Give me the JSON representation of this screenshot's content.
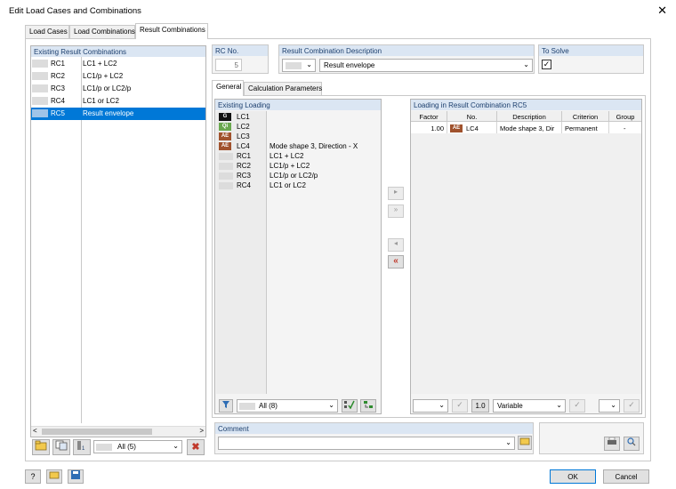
{
  "window": {
    "title": "Edit Load Cases and Combinations",
    "close_glyph": "✕"
  },
  "tabs": [
    {
      "label": "Load Cases"
    },
    {
      "label": "Load Combinations"
    },
    {
      "label": "Result Combinations"
    }
  ],
  "existing_rc": {
    "header": "Existing Result Combinations",
    "rows": [
      {
        "id": "RC1",
        "desc": "LC1 + LC2"
      },
      {
        "id": "RC2",
        "desc": "LC1/p + LC2"
      },
      {
        "id": "RC3",
        "desc": "LC1/p or LC2/p"
      },
      {
        "id": "RC4",
        "desc": "LC1 or LC2"
      },
      {
        "id": "RC5",
        "desc": "Result envelope"
      }
    ],
    "filter_value": "All (5)"
  },
  "rc_no": {
    "label": "RC No.",
    "value": "5"
  },
  "rc_desc": {
    "label": "Result Combination Description",
    "value": "Result envelope"
  },
  "to_solve": {
    "label": "To Solve",
    "checked": true
  },
  "sub_tabs": [
    {
      "label": "General"
    },
    {
      "label": "Calculation Parameters"
    }
  ],
  "existing_loading": {
    "header": "Existing Loading",
    "rows": [
      {
        "badge": "G",
        "badge_color": "#111111",
        "id": "LC1",
        "desc": ""
      },
      {
        "badge": "Qi",
        "badge_color": "#6aa84f",
        "id": "LC2",
        "desc": ""
      },
      {
        "badge": "AE",
        "badge_color": "#a0522d",
        "id": "LC3",
        "desc": ""
      },
      {
        "badge": "AE",
        "badge_color": "#a0522d",
        "id": "LC4",
        "desc": "Mode shape 3, Direction - X"
      },
      {
        "badge": "",
        "badge_color": "",
        "id": "RC1",
        "desc": "LC1 + LC2"
      },
      {
        "badge": "",
        "badge_color": "",
        "id": "RC2",
        "desc": "LC1/p + LC2"
      },
      {
        "badge": "",
        "badge_color": "",
        "id": "RC3",
        "desc": "LC1/p or LC2/p"
      },
      {
        "badge": "",
        "badge_color": "",
        "id": "RC4",
        "desc": "LC1 or LC2"
      }
    ],
    "filter_value": "All (8)"
  },
  "loading_in_rc": {
    "header": "Loading in Result Combination RC5",
    "columns": [
      "Factor",
      "No.",
      "Description",
      "Criterion",
      "Group"
    ],
    "rows": [
      {
        "factor": "1.00",
        "badge": "AE",
        "badge_color": "#a0522d",
        "no": "LC4",
        "description": "Mode shape 3, Dir",
        "criterion": "Permanent",
        "group": "-"
      }
    ],
    "factor_btn": "1.0",
    "criterion_value": "Variable"
  },
  "comment": {
    "label": "Comment",
    "value": ""
  },
  "footer": {
    "ok": "OK",
    "cancel": "Cancel"
  }
}
